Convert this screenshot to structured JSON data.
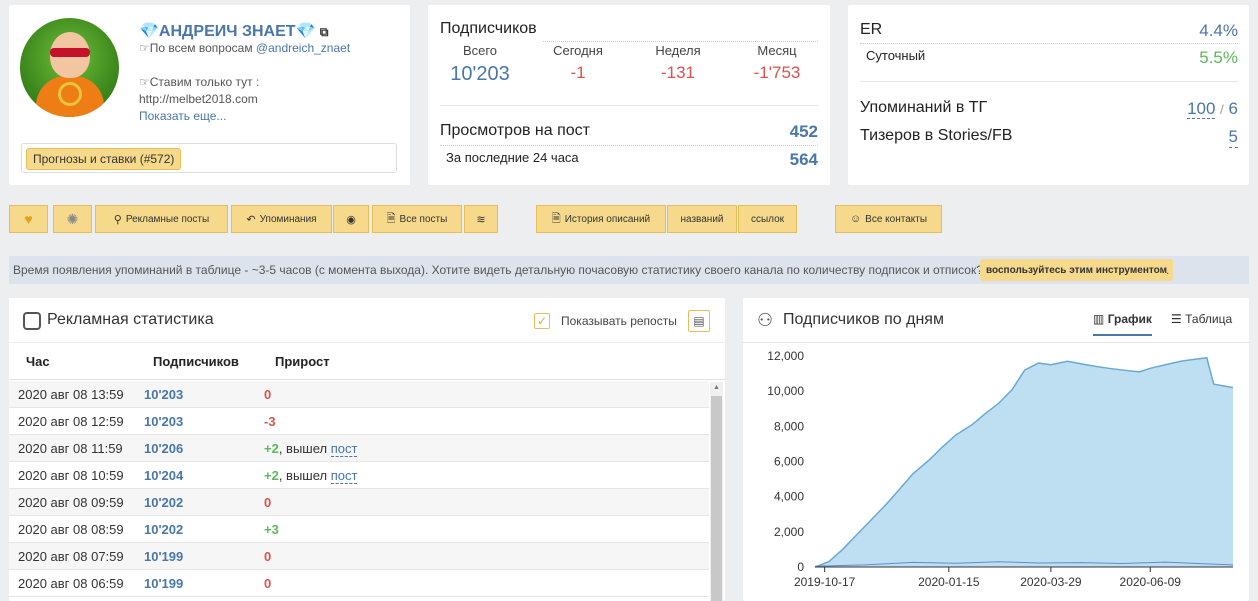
{
  "profile": {
    "name": "💎АНДРЕИЧ ЗНАЕТ💎",
    "line1_prefix": "☞По всем вопросам",
    "line1_handle": "@andreich_znaet",
    "line2": "☞Ставим только тут :",
    "line3": "http://melbet2018.com",
    "more": "Показать еще...",
    "tag": "Прогнозы и ставки (#572)"
  },
  "subscribers": {
    "title": "Подписчиков",
    "total_label": "Всего",
    "total": "10'203",
    "today_label": "Сегодня",
    "today": "-1",
    "week_label": "Неделя",
    "week": "-131",
    "month_label": "Месяц",
    "month": "-1'753",
    "views_label": "Просмотров на пост",
    "views": "452",
    "views24_label": "За последние 24 часа",
    "views24": "564"
  },
  "er": {
    "label": "ER",
    "value": "4.4%",
    "daily_label": "Суточный",
    "daily_value": "5.5%",
    "mentions_label": "Упоминаний в ТГ",
    "mentions_a": "100",
    "mentions_sep": "/",
    "mentions_b": "6",
    "teasers_label": "Тизеров в Stories/FB",
    "teasers": "5"
  },
  "toolbar": {
    "ads_posts": "Рекламные посты",
    "mentions": "Упоминания",
    "all_posts": "Все посты",
    "history_desc": "История описаний",
    "names": "названий",
    "links": "ссылок",
    "all_contacts": "Все контакты"
  },
  "info": {
    "text": "Время появления упоминаний в таблице - ~3-5 часов (с момента выхода). Хотите видеть детальную почасовую статистику своего канала по количеству подписок и отписок?",
    "button": "воспользуйтесь этим инструментом",
    "dot": "."
  },
  "ads": {
    "title": "Рекламная статистика",
    "show_reposts": "Показывать репосты",
    "col_hour": "Час",
    "col_subs": "Подписчиков",
    "col_growth": "Прирост",
    "rows": [
      {
        "date": "2020 авг 08 13:59",
        "subs": "10'203",
        "growth": "0",
        "note": "",
        "link": ""
      },
      {
        "date": "2020 авг 08 12:59",
        "subs": "10'203",
        "growth": "-3",
        "note": "",
        "link": ""
      },
      {
        "date": "2020 авг 08 11:59",
        "subs": "10'206",
        "growth": "+2",
        "note": ", вышел",
        "link": "пост"
      },
      {
        "date": "2020 авг 08 10:59",
        "subs": "10'204",
        "growth": "+2",
        "note": ", вышел",
        "link": "пост"
      },
      {
        "date": "2020 авг 08 09:59",
        "subs": "10'202",
        "growth": "0",
        "note": "",
        "link": ""
      },
      {
        "date": "2020 авг 08 08:59",
        "subs": "10'202",
        "growth": "+3",
        "note": "",
        "link": ""
      },
      {
        "date": "2020 авг 08 07:59",
        "subs": "10'199",
        "growth": "0",
        "note": "",
        "link": ""
      },
      {
        "date": "2020 авг 08 06:59",
        "subs": "10'199",
        "growth": "0",
        "note": "",
        "link": ""
      }
    ]
  },
  "daily": {
    "title": "Подписчиков по дням",
    "tab_chart": "График",
    "tab_table": "Таблица"
  },
  "chart_data": {
    "type": "area",
    "title": "",
    "xlabel": "",
    "ylabel": "",
    "ylim": [
      0,
      12000
    ],
    "yticks": [
      "0",
      "2,000",
      "4,000",
      "6,000",
      "8,000",
      "10,000",
      "12,000"
    ],
    "xticks": [
      "2019-10-17",
      "2020-01-15",
      "2020-03-29",
      "2020-06-09"
    ],
    "x_range": [
      "2019-10-10",
      "2020-08-08"
    ],
    "series": [
      {
        "x": [
          "2019-10-10",
          "2019-10-20",
          "2019-10-30",
          "2019-11-10",
          "2019-11-20",
          "2019-12-01",
          "2019-12-10",
          "2019-12-20",
          "2020-01-01",
          "2020-01-10",
          "2020-01-20",
          "2020-02-01",
          "2020-02-10",
          "2020-02-20",
          "2020-03-01",
          "2020-03-10",
          "2020-03-20",
          "2020-03-29",
          "2020-04-10",
          "2020-04-20",
          "2020-05-01",
          "2020-05-10",
          "2020-05-20",
          "2020-06-01",
          "2020-06-09",
          "2020-06-20",
          "2020-07-01",
          "2020-07-10",
          "2020-07-20",
          "2020-07-25",
          "2020-08-01",
          "2020-08-08"
        ],
        "values": [
          0,
          300,
          1000,
          1900,
          2700,
          3600,
          4400,
          5300,
          6100,
          6800,
          7500,
          8100,
          8700,
          9300,
          10100,
          11200,
          11600,
          11500,
          11700,
          11550,
          11400,
          11300,
          11200,
          11100,
          11300,
          11500,
          11700,
          11800,
          11900,
          10400,
          10300,
          10203
        ],
        "color": "#a8d4ec"
      },
      {
        "x": [
          "2019-10-10",
          "2019-11-15",
          "2019-12-20",
          "2020-01-20",
          "2020-02-20",
          "2020-03-20",
          "2020-04-20",
          "2020-05-20",
          "2020-06-20",
          "2020-07-20",
          "2020-08-08"
        ],
        "values": [
          40,
          120,
          260,
          210,
          300,
          230,
          250,
          200,
          280,
          180,
          120
        ],
        "color": "#5b8fc9"
      }
    ]
  },
  "colors": {
    "accent": "#4a76a8",
    "button": "#f7d98c",
    "negative": "#d9534f",
    "positive": "#5cb85c"
  }
}
